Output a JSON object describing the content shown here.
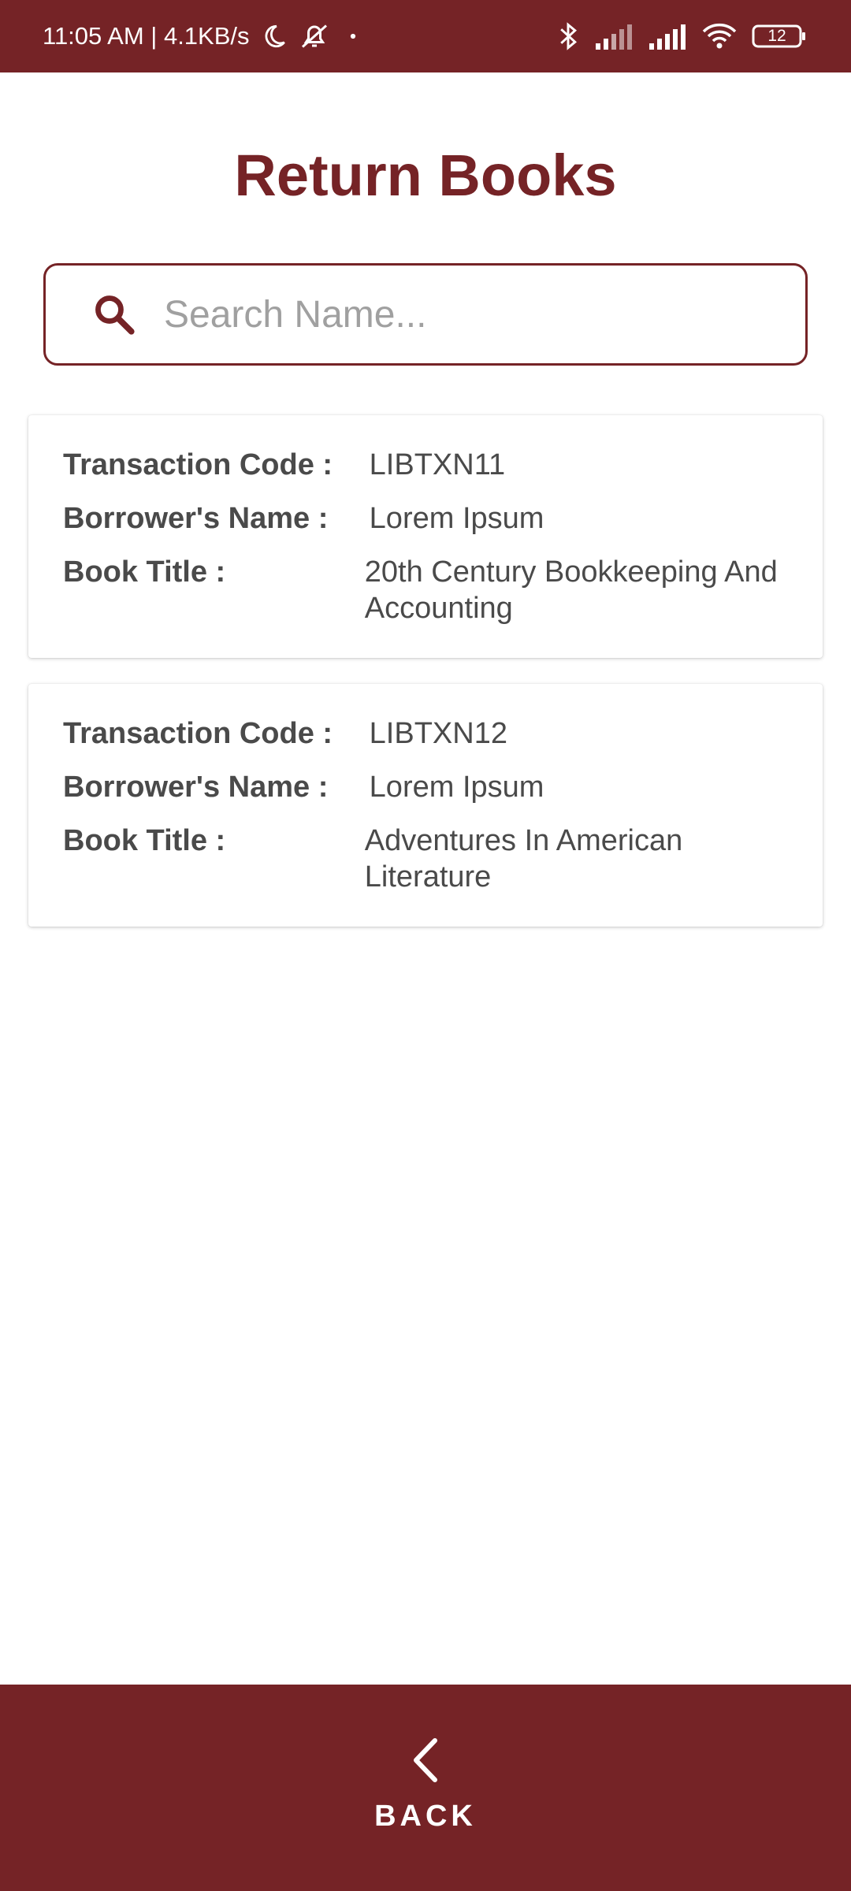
{
  "status_bar": {
    "time_speed": "11:05 AM | 4.1KB/s",
    "battery": "12",
    "icons": [
      "moon-icon",
      "notifications-off-icon",
      "dot-icon",
      "bluetooth-icon",
      "signal-icon",
      "signal-icon",
      "wifi-icon",
      "battery-icon"
    ]
  },
  "page": {
    "title": "Return Books"
  },
  "search": {
    "placeholder": "Search Name...",
    "value": ""
  },
  "transactions": [
    {
      "code_label": "Transaction Code :",
      "code": "LIBTXN11",
      "name_label": "Borrower's Name :",
      "name": "Lorem Ipsum",
      "title_label": "Book Title :",
      "title": "20th Century Bookkeeping And Accounting"
    },
    {
      "code_label": "Transaction Code :",
      "code": "LIBTXN12",
      "name_label": "Borrower's Name :",
      "name": "Lorem Ipsum",
      "title_label": "Book Title :",
      "title": "Adventures In American Literature"
    }
  ],
  "footer": {
    "back_label": "BACK"
  },
  "colors": {
    "primary": "#752326",
    "text": "#4a4a4a",
    "placeholder": "#a0a0a0"
  }
}
